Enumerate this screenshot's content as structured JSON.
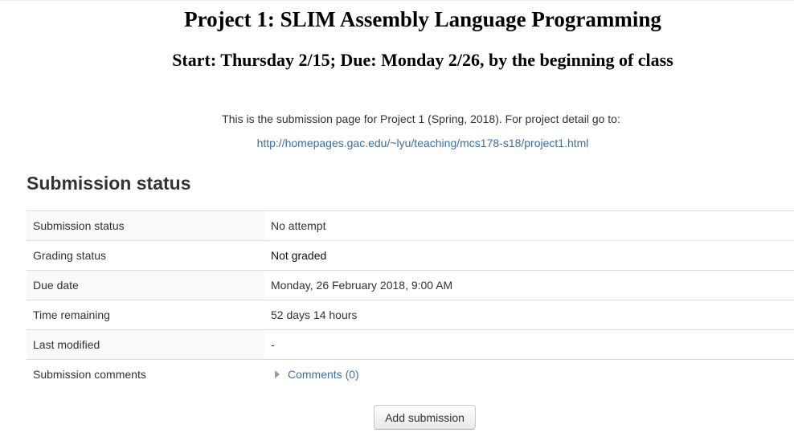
{
  "header": {
    "title": "Project 1: SLIM Assembly Language Programming",
    "subtitle": "Start: Thursday 2/15; Due: Monday 2/26, by the beginning of class"
  },
  "intro": {
    "text": "This is the submission page for Project 1 (Spring, 2018). For project detail go to:",
    "link": "http://homepages.gac.edu/~lyu/teaching/mcs178-s18/project1.html"
  },
  "section": {
    "heading": "Submission status"
  },
  "status_rows": [
    {
      "label": "Submission status",
      "value": "No attempt"
    },
    {
      "label": "Grading status",
      "value": "Not graded"
    },
    {
      "label": "Due date",
      "value": "Monday, 26 February 2018, 9:00 AM"
    },
    {
      "label": "Time remaining",
      "value": "52 days 14 hours"
    },
    {
      "label": "Last modified",
      "value": "-"
    },
    {
      "label": "Submission comments",
      "value": "Comments (0)"
    }
  ],
  "icons": {
    "comments_toggle": "caret-right-icon"
  },
  "actions": {
    "add_submission_label": "Add submission"
  },
  "colors": {
    "link": "#3d6fa2",
    "grading_cell_bg": "#eeeeee"
  }
}
